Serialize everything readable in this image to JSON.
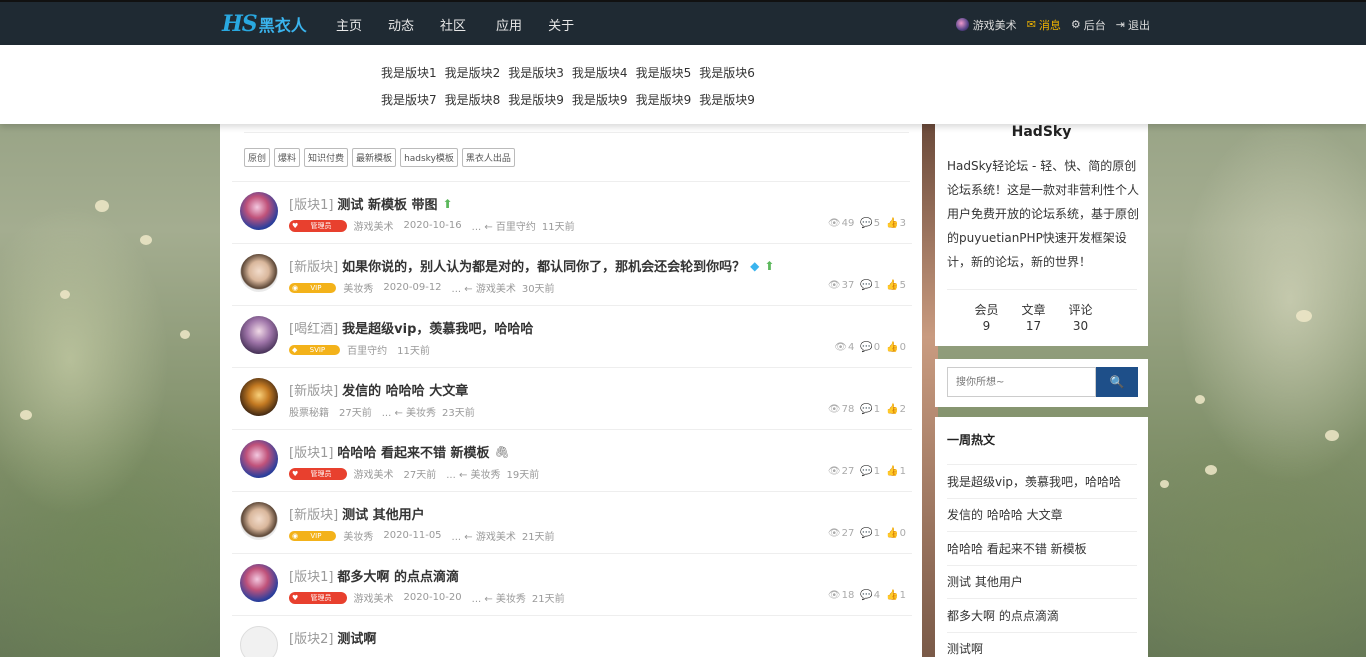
{
  "brand": {
    "mark": "HS",
    "name": "黑衣人"
  },
  "nav": {
    "items": [
      "主页",
      "动态",
      "社区",
      "应用",
      "关于"
    ],
    "right": {
      "user": "游戏美术",
      "messages": "消息",
      "admin": "后台",
      "logout": "退出"
    }
  },
  "dropdown": {
    "row1": [
      "我是版块1",
      "我是版块2",
      "我是版块3",
      "我是版块4",
      "我是版块5",
      "我是版块6"
    ],
    "row2": [
      "我是版块7",
      "我是版块8",
      "我是版块9",
      "我是版块9",
      "我是版块9",
      "我是版块9"
    ]
  },
  "tags": [
    "原创",
    "爆料",
    "知识付费",
    "最新模板",
    "hadsky模板",
    "黑衣人出品"
  ],
  "posts": [
    {
      "board": "[版块1]",
      "title": "测试 新模板 带图",
      "badge": "管理员",
      "author": "游戏美术",
      "date": "2020-10-16",
      "reply": "... ← 百里守约",
      "ago": "11天前",
      "views": "49",
      "comments": "5",
      "likes": "3"
    },
    {
      "board": "[新版块]",
      "title": "如果你说的，别人认为都是对的，都认同你了，那机会还会轮到你吗？",
      "badge": "VIP",
      "author": "美妆秀",
      "date": "2020-09-12",
      "reply": "... ← 游戏美术",
      "ago": "30天前",
      "views": "37",
      "comments": "1",
      "likes": "5"
    },
    {
      "board": "[喝红酒]",
      "title": "我是超级vip，羡慕我吧，哈哈哈",
      "badge": "SVIP",
      "author": "百里守约",
      "date": "",
      "reply": "",
      "ago": "11天前",
      "views": "4",
      "comments": "0",
      "likes": "0"
    },
    {
      "board": "[新版块]",
      "title": "发信的 哈哈哈 大文章",
      "badge": "",
      "author": "股票秘籍",
      "date": "27天前",
      "reply": "... ← 美妆秀",
      "ago": "23天前",
      "views": "78",
      "comments": "1",
      "likes": "2"
    },
    {
      "board": "[版块1]",
      "title": "哈哈哈 看起来不错 新模板",
      "badge": "管理员",
      "author": "游戏美术",
      "date": "27天前",
      "reply": "... ← 美妆秀",
      "ago": "19天前",
      "views": "27",
      "comments": "1",
      "likes": "1"
    },
    {
      "board": "[新版块]",
      "title": "测试 其他用户",
      "badge": "VIP",
      "author": "美妆秀",
      "date": "2020-11-05",
      "reply": "... ← 游戏美术",
      "ago": "21天前",
      "views": "27",
      "comments": "1",
      "likes": "0"
    },
    {
      "board": "[版块1]",
      "title": "都多大啊 的点点滴滴",
      "badge": "管理员",
      "author": "游戏美术",
      "date": "2020-10-20",
      "reply": "... ← 美妆秀",
      "ago": "21天前",
      "views": "18",
      "comments": "4",
      "likes": "1"
    },
    {
      "board": "[版块2]",
      "title": "测试啊"
    }
  ],
  "profile": {
    "name": "HadSky",
    "description": "HadSky轻论坛 - 轻、快、简的原创论坛系统！这是一款对非营利性个人用户免费开放的论坛系统，基于原创的puyuetianPHP快速开发框架设计，新的论坛，新的世界！",
    "stats": [
      {
        "label": "会员",
        "value": "9"
      },
      {
        "label": "文章",
        "value": "17"
      },
      {
        "label": "评论",
        "value": "30"
      }
    ]
  },
  "search": {
    "placeholder": "搜你所想~"
  },
  "hot": {
    "title": "一周热文",
    "items": [
      "我是超级vip，羡慕我吧，哈哈哈",
      "发信的 哈哈哈 大文章",
      "哈哈哈 看起来不错 新模板",
      "测试 其他用户",
      "都多大啊 的点点滴滴",
      "测试啊"
    ]
  },
  "colors": {
    "topbar": "#1f2a33",
    "accent": "#29a8e0",
    "search_button": "#1e4f89",
    "admin_badge": "#e8402e",
    "vip_badge": "#f3b21a",
    "up_arrow": "#5cb85c"
  }
}
